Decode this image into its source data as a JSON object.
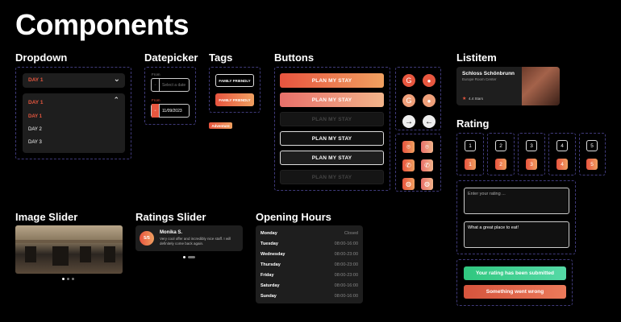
{
  "title": "Components",
  "sections": {
    "dropdown": "Dropdown",
    "datepicker": "Datepicker",
    "tags": "Tags",
    "buttons": "Buttons",
    "listitem": "Listitem",
    "rating": "Rating",
    "image_slider": "Image Slider",
    "ratings_slider": "Ratings Slider",
    "opening_hours": "Opening Hours"
  },
  "dropdown": {
    "closed_value": "DAY 1",
    "open_value": "DAY 1",
    "options": [
      "DAY 1",
      "DAY 2",
      "DAY 3"
    ]
  },
  "datepicker": {
    "from_label_1": "From",
    "placeholder": "Select a date",
    "from_label_2": "From",
    "value": "11/09/2023"
  },
  "tags": {
    "outline": "FAMILY FRIENDLY",
    "filled": "FAMILY FRIENDLY",
    "chip": "Adventure"
  },
  "buttons": {
    "labels": [
      "PLAN MY STAY",
      "PLAN MY STAY",
      "PLAN MY STAY",
      "PLAN MY STAY",
      "PLAN MY STAY",
      "PLAN MY STAY"
    ]
  },
  "listitem": {
    "title": "Schloss Schönbrunn",
    "subtitle": "Europe Room Center",
    "rating": "4.4 Stars"
  },
  "rating": {
    "values": [
      "1",
      "2",
      "3",
      "4",
      "5"
    ],
    "input_placeholder": "Enter your rating ...",
    "input_value": "What a great place to eat!",
    "success": "Your rating has been submitted",
    "error": "Something went wrong"
  },
  "ratings_slider": {
    "score": "5/5",
    "name": "Monika S.",
    "text": "Very cool offer and incredibly nice staff. I will definitely come back again."
  },
  "opening_hours": {
    "rows": [
      {
        "day": "Monday",
        "time": "Closed"
      },
      {
        "day": "Tuesday",
        "time": "08:00-16:00"
      },
      {
        "day": "Wednesday",
        "time": "08:00-23:00"
      },
      {
        "day": "Thursday",
        "time": "08:00-23:00"
      },
      {
        "day": "Friday",
        "time": "08:00-23:00"
      },
      {
        "day": "Saturday",
        "time": "08:00-16:00"
      },
      {
        "day": "Sunday",
        "time": "08:00-16:00"
      }
    ]
  },
  "colors": {
    "accent": "#e8573f",
    "success": "#3fcf8e",
    "error": "#e0604a",
    "panel": "#1e1e1e",
    "dash": "#3f3a7a"
  }
}
